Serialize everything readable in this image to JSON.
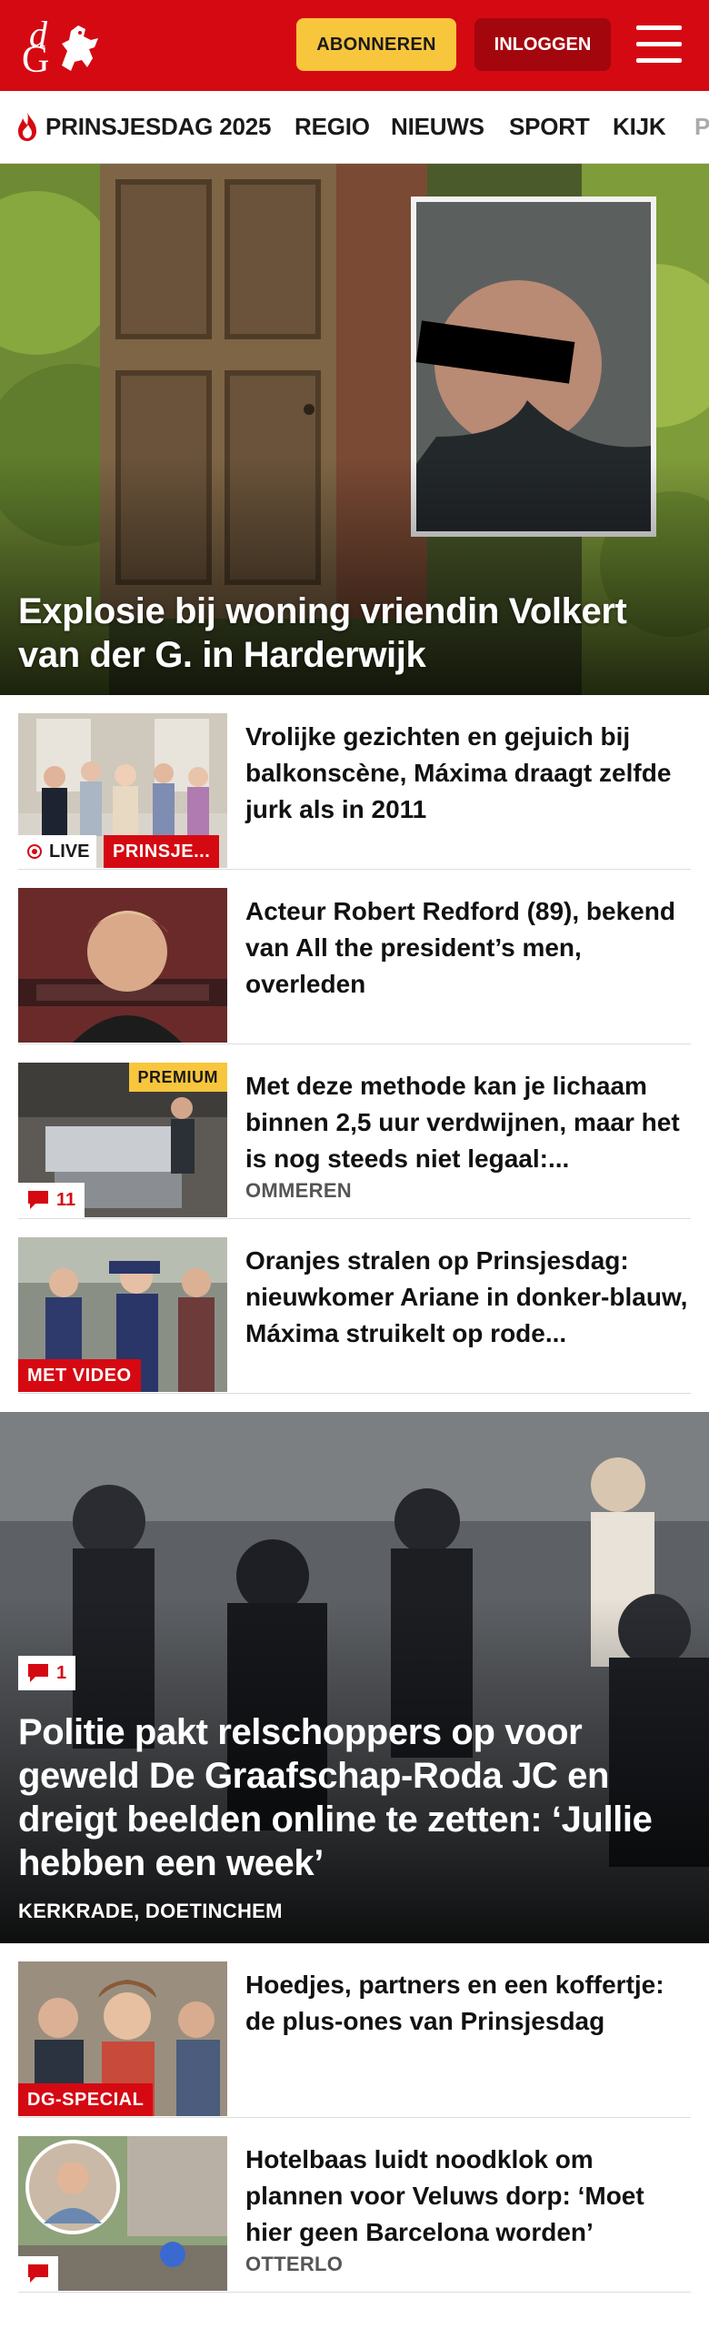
{
  "header": {
    "logo_d": "d",
    "logo_g": "G",
    "subscribe_label": "ABONNEREN",
    "login_label": "INLOGGEN"
  },
  "nav": {
    "items": [
      "PRINSJESDAG 2025",
      "REGIO",
      "NIEUWS",
      "SPORT",
      "KIJK",
      "P"
    ]
  },
  "hero": {
    "title": "Explosie bij woning vriendin Volkert van der G. in Harderwijk"
  },
  "articles": [
    {
      "title": "Vrolijke gezichten en gejuich bij balkonscène, Máxima draagt zelfde jurk als in 2011",
      "live_label": "LIVE",
      "tag": "PRINSJE..."
    },
    {
      "title": "Acteur Robert Redford (89), bekend van All the president’s men, overleden"
    },
    {
      "title": "Met deze methode kan je lichaam binnen 2,5 uur verdwijnen, maar het is nog steeds niet legaal:...",
      "premium_label": "PREMIUM",
      "comments": "11",
      "location": "OMMEREN"
    },
    {
      "title": "Oranjes stralen op Prinsjesdag: nieuwkomer Ariane in donker-blauw, Máxima struikelt op rode...",
      "tag": "MET VIDEO"
    }
  ],
  "big_story": {
    "title": "Politie pakt relschoppers op voor geweld De Graafschap-Roda JC en dreigt beelden online te zetten: ‘Jullie hebben een week’",
    "comments": "1",
    "location": "KERKRADE, DOETINCHEM"
  },
  "articles2": [
    {
      "title": "Hoedjes, partners en een koffertje: de plus-ones van Prinsjesdag",
      "tag": "DG-SPECIAL"
    },
    {
      "title": "Hotelbaas luidt noodklok om plannen voor Veluws dorp: ‘Moet hier geen Barcelona worden’",
      "location": "OTTERLO"
    }
  ],
  "colors": {
    "brand_red": "#d50912",
    "dark_red": "#a3060d",
    "accent_yellow": "#f8c63d"
  }
}
